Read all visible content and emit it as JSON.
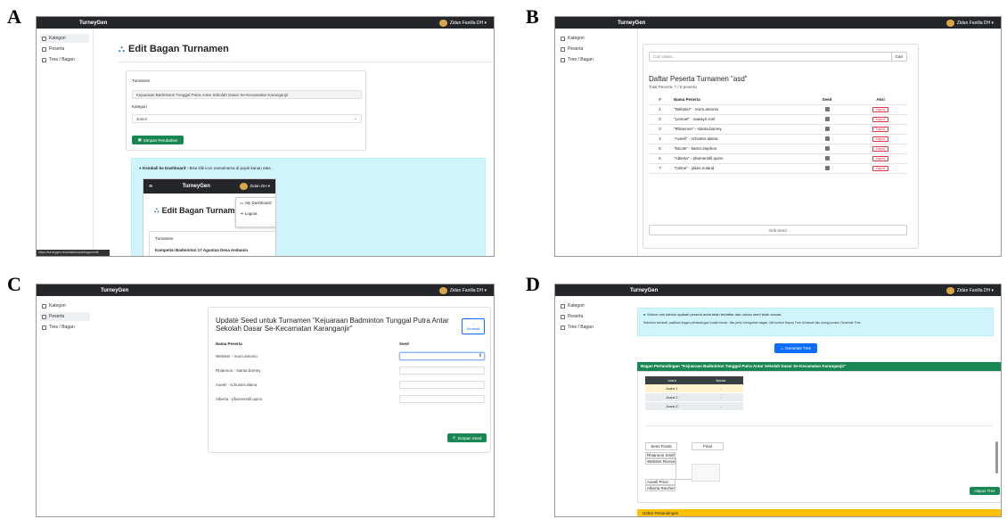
{
  "panel_labels": [
    "A",
    "B",
    "C",
    "D"
  ],
  "app": {
    "brand": "TurneyGen",
    "user": "Zidan Fanilla DH ▾"
  },
  "sidebar": {
    "items": [
      "Kategori",
      "Peserta",
      "Tree / Bagan"
    ]
  },
  "a": {
    "title": "Edit Bagan Turnamen",
    "turnamen_label": "Turnamen",
    "turnamen_value": "Kejuaraan Badminton Tunggal Putra Antar Sekolah Dasar Se-Kecamatan Karanganjir",
    "kategori_label": "Kategori",
    "kategori_value": "Junior",
    "save": "Simpan Perubahan",
    "hint_bold": "Kembali ke Dashboard :",
    "hint_text": "Bisa klik icon nama/nama di pojok kanan atas.",
    "inner_user": "Zidan DH ▾",
    "menu_dashboard": "My Dashboard",
    "menu_logout": "Logout",
    "inner_turnamen_label": "Turnamen",
    "inner_turnamen_value": "Kompetisi Badminton 17 Agustus Desa Ambanin",
    "status_url": "https://turneygen.test/dashboard/bagan/edit"
  },
  "b": {
    "search_placeholder": "Cari siswa...",
    "search_btn": "Cari",
    "title": "Daftar Peserta Turnamen \"asd\"",
    "subtitle": "Total Peserta: 7 / 8 peserta",
    "columns": [
      "#",
      "Nama Peserta",
      "Seed",
      "Aksi"
    ],
    "rows": [
      {
        "n": "1",
        "name": "\"Webster\" - reum.antonio"
      },
      {
        "n": "2",
        "name": "\"Lemuel\" - sawayn.roel"
      },
      {
        "n": "3",
        "name": "\"Rhiannon\" - stanta.barney"
      },
      {
        "n": "4",
        "name": "\"Axeeli\" - schuster.alaina"
      },
      {
        "n": "5",
        "name": "\"Nicole\" - karen.stephon"
      },
      {
        "n": "6",
        "name": "\"Alberta\" - pfannerstill.quinn"
      },
      {
        "n": "7",
        "name": "\"Celine\" - jakes.noland"
      }
    ],
    "hapus": "Hapus",
    "edit_seed": "Edit Seed"
  },
  "c": {
    "title": "Update Seed untuk Turnamen \"Kejuaraan Badminton Tunggal Putra Antar Sekolah Dasar Se-Kecamatan Karanganjir\"",
    "back": "Kembali",
    "col_name": "Nama Peserta",
    "col_seed": "Seed",
    "rows": [
      "Webster - reum.antonio",
      "Rhiannon - stanta.barney",
      "Axeeli - schuster.alaina",
      "Alberta - pfannerstill.quinn"
    ],
    "save": "Simpan Seed"
  },
  "d": {
    "info_text": "Mohon cek dahulu apakah peserta anda telah terdaftar dan urutan seed telah sesuai.",
    "info_detail": "Sebelum kembali, pastikan bagan pertandingan sudah benar. Jika perlu mengubah bagan, klik tombol Hapus Tree di bawah lalu ulangi proses Generate Tree.",
    "generate": "Generate Tree",
    "bagan_title": "Bagan Pertandingan \"Kejuaraan Badminton Tunggal Putra Antar Sekolah Dasar Se-Kecamatan Karanganjir\"",
    "juara_cols": [
      "Juara",
      "Nama"
    ],
    "juara_rows": [
      [
        "Juara 1",
        "-"
      ],
      [
        "Juara 2",
        "-"
      ],
      [
        "Juara 3",
        "-"
      ]
    ],
    "semi": "Semi Finals",
    "final": "Final",
    "players": [
      "Rhiannon Smith",
      "Webster Rivera",
      "Axeeli Price",
      "Alberta Reichert"
    ],
    "hapus_tree": "Hapus Tree",
    "daftar": "Daftar Pertandingan"
  }
}
